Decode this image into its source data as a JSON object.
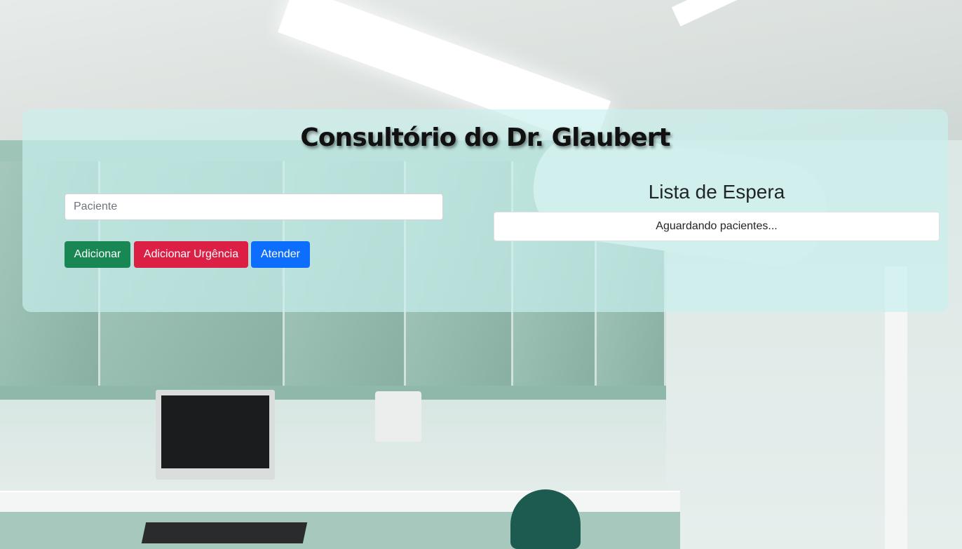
{
  "page": {
    "title": "Consultório do Dr. Glaubert"
  },
  "form": {
    "patient_placeholder": "Paciente",
    "patient_value": "",
    "add_label": "Adicionar",
    "add_urgent_label": "Adicionar Urgência",
    "attend_label": "Atender"
  },
  "queue": {
    "title": "Lista de Espera",
    "items": [
      "Aguardando pacientes..."
    ]
  },
  "colors": {
    "add_button": "#198754",
    "urgent_button": "#dc1f45",
    "attend_button": "#0d6efd",
    "panel_tint": "#c8f0ee"
  }
}
